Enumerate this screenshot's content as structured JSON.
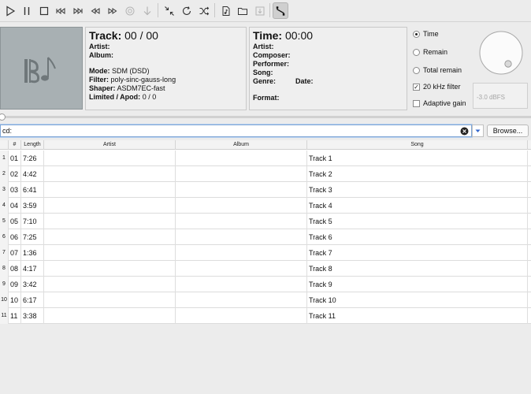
{
  "toolbar": {
    "buttons": [
      {
        "icon": "play-icon"
      },
      {
        "icon": "pause-icon"
      },
      {
        "icon": "stop-icon"
      },
      {
        "icon": "previous-track-icon"
      },
      {
        "icon": "next-track-icon"
      },
      {
        "icon": "rewind-icon"
      },
      {
        "icon": "fast-forward-icon"
      },
      {
        "icon": "record-icon"
      },
      {
        "icon": "download-arrow-icon"
      },
      {
        "icon": "shrink-icon"
      },
      {
        "icon": "repeat-icon"
      },
      {
        "icon": "shuffle-icon"
      },
      {
        "icon": "open-file-icon"
      },
      {
        "icon": "open-folder-icon"
      },
      {
        "icon": "save-icon"
      },
      {
        "icon": "signal-path-icon",
        "active": true
      }
    ]
  },
  "track_panel": {
    "track_label": "Track:",
    "track_value": "00 / 00",
    "artist_label": "Artist:",
    "album_label": "Album:",
    "mode_label": "Mode:",
    "mode_value": "SDM (DSD)",
    "filter_label": "Filter:",
    "filter_value": "poly-sinc-gauss-long",
    "shaper_label": "Shaper:",
    "shaper_value": "ASDM7EC-fast",
    "limited_label": "Limited / Apod:",
    "limited_value": "0 / 0"
  },
  "time_panel": {
    "time_label": "Time:",
    "time_value": "00:00",
    "artist_label": "Artist:",
    "composer_label": "Composer:",
    "performer_label": "Performer:",
    "song_label": "Song:",
    "genre_label": "Genre:",
    "date_label": "Date:",
    "format_label": "Format:"
  },
  "options": {
    "time_label": "Time",
    "remain_label": "Remain",
    "total_remain_label": "Total remain",
    "filter_20khz_label": "20 kHz filter",
    "adaptive_gain_label": "Adaptive gain",
    "selected": "Time",
    "filter_20khz_checked": true,
    "adaptive_gain_checked": false,
    "volume_readout": "-3.0 dBFS"
  },
  "path_bar": {
    "value": "cd:",
    "browse_label": "Browse..."
  },
  "table": {
    "columns": [
      "#",
      "Length",
      "Artist",
      "Album",
      "Song"
    ],
    "rows": [
      {
        "n": "1",
        "num": "01",
        "length": "7:26",
        "artist": "",
        "album": "",
        "song": "Track 1"
      },
      {
        "n": "2",
        "num": "02",
        "length": "4:42",
        "artist": "",
        "album": "",
        "song": "Track 2"
      },
      {
        "n": "3",
        "num": "03",
        "length": "6:41",
        "artist": "",
        "album": "",
        "song": "Track 3"
      },
      {
        "n": "4",
        "num": "04",
        "length": "3:59",
        "artist": "",
        "album": "",
        "song": "Track 4"
      },
      {
        "n": "5",
        "num": "05",
        "length": "7:10",
        "artist": "",
        "album": "",
        "song": "Track 5"
      },
      {
        "n": "6",
        "num": "06",
        "length": "7:25",
        "artist": "",
        "album": "",
        "song": "Track 6"
      },
      {
        "n": "7",
        "num": "07",
        "length": "1:36",
        "artist": "",
        "album": "",
        "song": "Track 7"
      },
      {
        "n": "8",
        "num": "08",
        "length": "4:17",
        "artist": "",
        "album": "",
        "song": "Track 8"
      },
      {
        "n": "9",
        "num": "09",
        "length": "3:42",
        "artist": "",
        "album": "",
        "song": "Track 9"
      },
      {
        "n": "10",
        "num": "10",
        "length": "6:17",
        "artist": "",
        "album": "",
        "song": "Track 10"
      },
      {
        "n": "11",
        "num": "11",
        "length": "3:38",
        "artist": "",
        "album": "",
        "song": "Track 11"
      }
    ]
  }
}
